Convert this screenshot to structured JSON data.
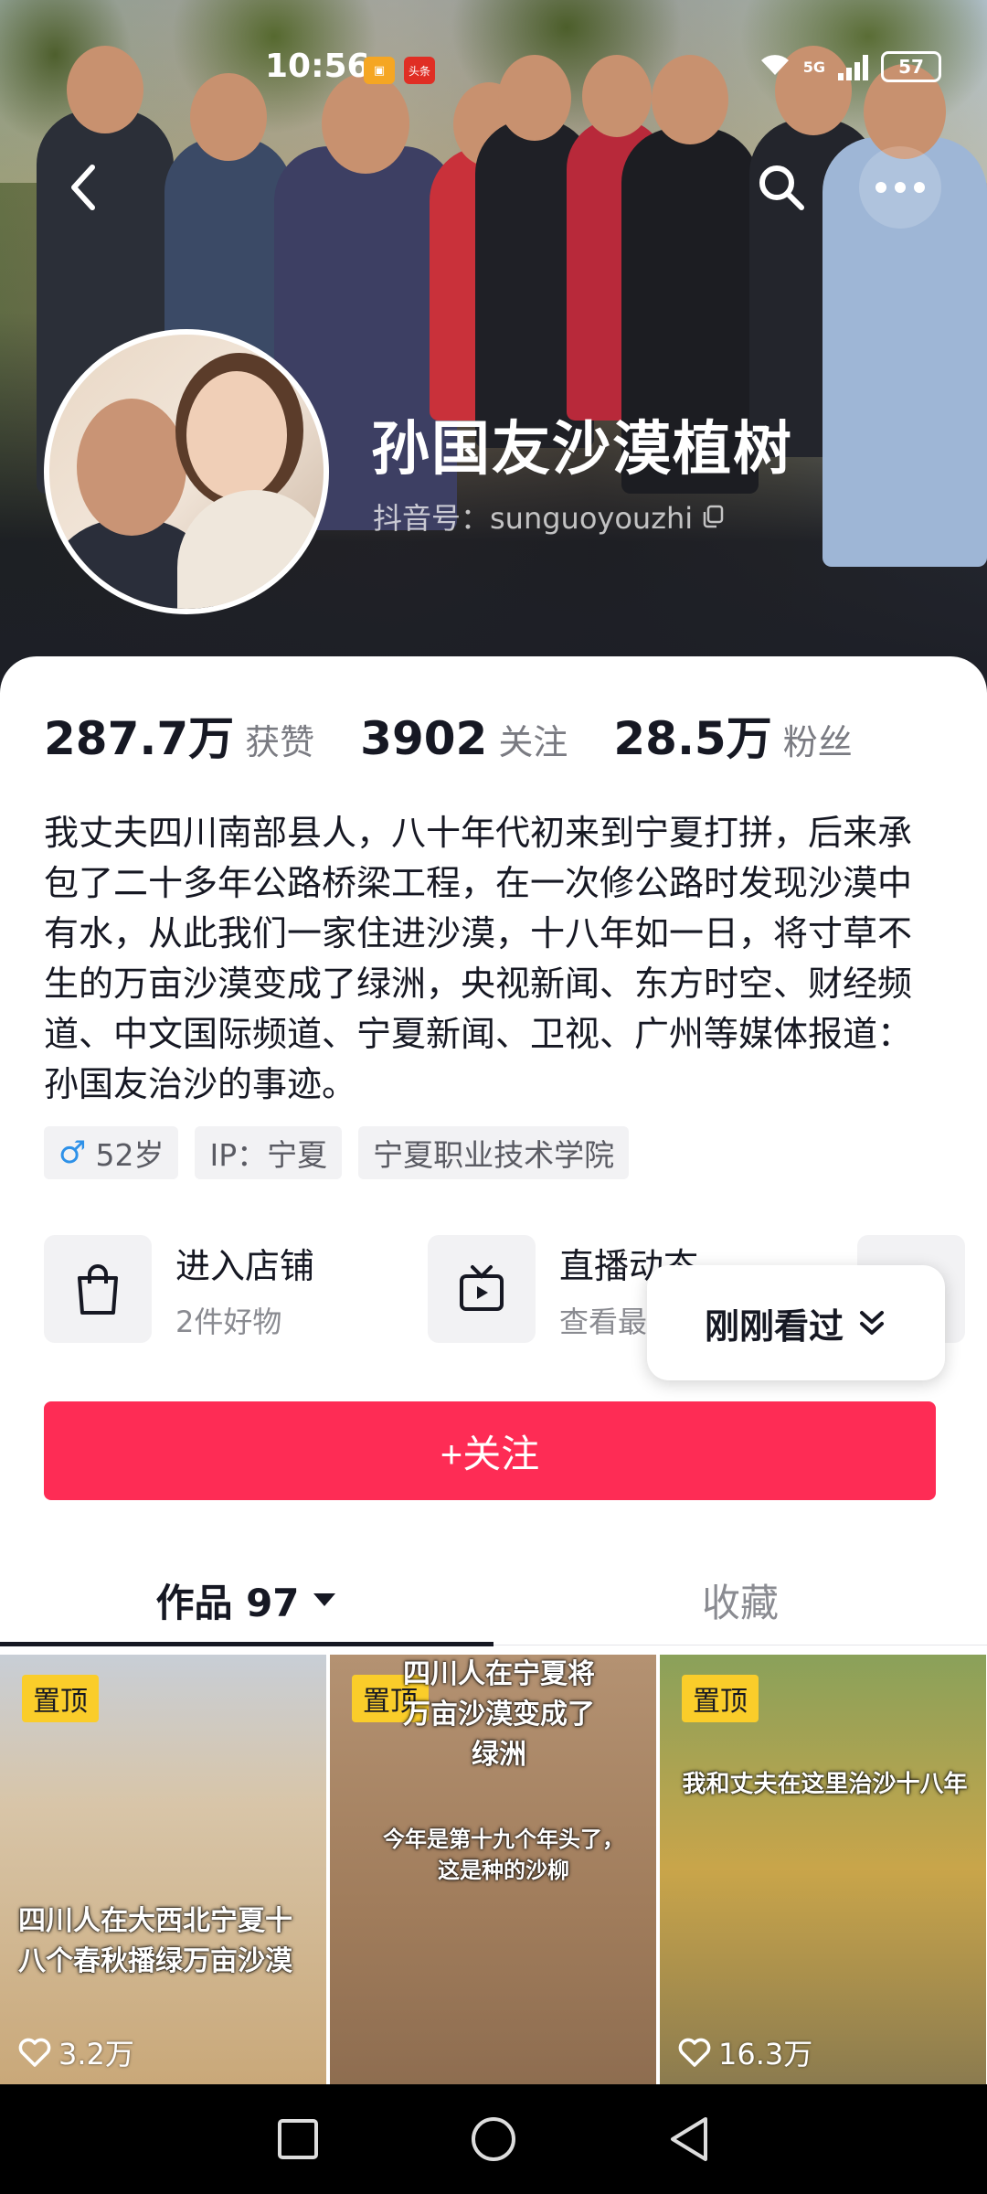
{
  "status_bar": {
    "time": "10:56",
    "notif_badge": "头条",
    "network": "5G",
    "battery": "57"
  },
  "profile": {
    "name": "孙国友沙漠植树",
    "douyin_id": "抖音号：sunguoyouzhi"
  },
  "stats": [
    {
      "num": "287.7万",
      "label": "获赞"
    },
    {
      "num": "3902",
      "label": "关注"
    },
    {
      "num": "28.5万",
      "label": "粉丝"
    }
  ],
  "bio": "我丈夫四川南部县人，八十年代初来到宁夏打拼，后来承包了二十多年公路桥梁工程，在一次修公路时发现沙漠中有水，从此我们一家住进沙漠，十八年如一日，将寸草不生的万亩沙漠变成了绿洲，央视新闻、东方时空、财经频道、中文国际频道、宁夏新闻、卫视、广州等媒体报道：孙国友治沙的事迹。",
  "tags": {
    "age": "52岁",
    "ip": "IP：宁夏",
    "school": "宁夏职业技术学院"
  },
  "entries": {
    "shop_title": "进入店铺",
    "shop_sub": "2件好物",
    "live_title": "直播动态",
    "live_sub": "查看最新回放"
  },
  "follow_button": "+关注",
  "tabs": {
    "works": "作品 97",
    "favorites": "收藏"
  },
  "videos": [
    {
      "pin": "置顶",
      "caption": "四川人在大西北宁夏十八个春秋播绿万亩沙漠",
      "likes": "3.2万"
    },
    {
      "pin": "置顶",
      "caption_top": "四川人在宁夏将万亩沙漠变成了绿洲",
      "caption_mid": "今年是第十九个年头了，这是种的沙柳"
    },
    {
      "pin": "置顶",
      "caption": "我和丈夫在这里治沙十八年",
      "likes": "16.3万"
    }
  ],
  "recent_popup": "刚刚看过",
  "colors": {
    "accent": "#fe2c55",
    "pin_yellow": "#facd2a",
    "male_blue": "#2e91e8"
  }
}
